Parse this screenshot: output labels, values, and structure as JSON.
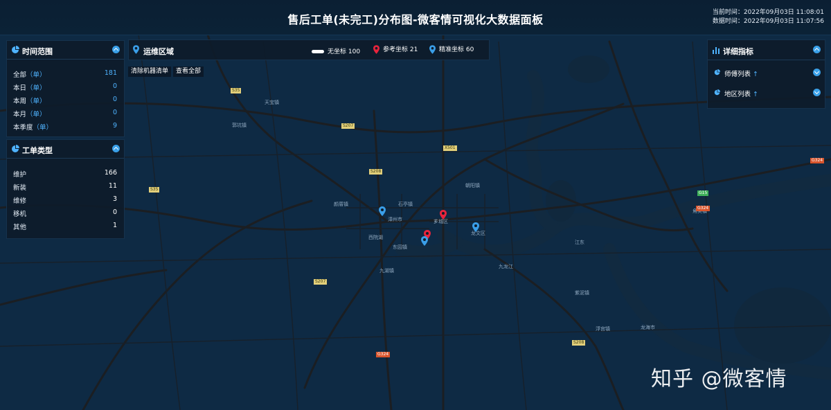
{
  "header": {
    "title": "售后工单(未完工)分布图-微客情可视化大数据面板",
    "current_time": "当前时间：2022年09月03日 11:08:01",
    "data_time": "数据时间：2022年09月03日 11:07:56"
  },
  "time_range": {
    "title": "时间范围",
    "unit": "（单）",
    "rows": [
      {
        "label": "全部",
        "value": "181"
      },
      {
        "label": "本日",
        "value": "0"
      },
      {
        "label": "本周",
        "value": "0"
      },
      {
        "label": "本月",
        "value": "0"
      },
      {
        "label": "本季度",
        "value": "9"
      }
    ]
  },
  "order_type": {
    "title": "工单类型",
    "rows": [
      {
        "label": "维护",
        "value": "166"
      },
      {
        "label": "新装",
        "value": "11"
      },
      {
        "label": "维修",
        "value": "3"
      },
      {
        "label": "移机",
        "value": "0"
      },
      {
        "label": "其他",
        "value": "1"
      }
    ]
  },
  "region": {
    "title": "运维区域",
    "legend": [
      {
        "label": "无坐标 100",
        "color": "#ffffff",
        "icon": "bar-icon"
      },
      {
        "label": "参考坐标 21",
        "color": "#e8243c",
        "icon": "pin-icon"
      },
      {
        "label": "精准坐标 60",
        "color": "#3a9ee8",
        "icon": "pin-icon"
      }
    ],
    "buttons": [
      "清除机器清单",
      "查看全部"
    ]
  },
  "detail": {
    "title": "详细指标",
    "items": [
      {
        "label": "师傅列表",
        "arrow": "↑"
      },
      {
        "label": "地区列表",
        "arrow": "↑"
      }
    ]
  },
  "map": {
    "water_color": "#122c47",
    "road_color": "#1a1f24",
    "pins": [
      {
        "type": "precise",
        "color": "#3a9ee8"
      },
      {
        "type": "reference",
        "color": "#e8243c"
      },
      {
        "type": "reference",
        "color": "#e8243c"
      },
      {
        "type": "precise",
        "color": "#3a9ee8"
      },
      {
        "type": "precise",
        "color": "#3a9ee8"
      }
    ],
    "labels": [
      "漳州市",
      "西院湖",
      "东园镇",
      "龙海市",
      "朝阳镇",
      "石亭镇",
      "九湖镇",
      "九龙江",
      "郭坑镇",
      "天宝镇",
      "颜厝镇",
      "浮宫镇",
      "紫泥镇",
      "角美镇",
      "江东",
      "芗城区",
      "龙文区"
    ],
    "shields": [
      {
        "text": "S35",
        "style": "yellow"
      },
      {
        "text": "S35",
        "style": "yellow"
      },
      {
        "text": "S207",
        "style": "yellow"
      },
      {
        "text": "S208",
        "style": "yellow"
      },
      {
        "text": "G15",
        "style": "green"
      },
      {
        "text": "G324",
        "style": "red"
      },
      {
        "text": "G324",
        "style": "red"
      },
      {
        "text": "G324",
        "style": "red"
      },
      {
        "text": "S208",
        "style": "yellow"
      },
      {
        "text": "X501",
        "style": "yellow"
      },
      {
        "text": "S207",
        "style": "yellow"
      }
    ]
  },
  "watermark": "知乎 @微客情"
}
